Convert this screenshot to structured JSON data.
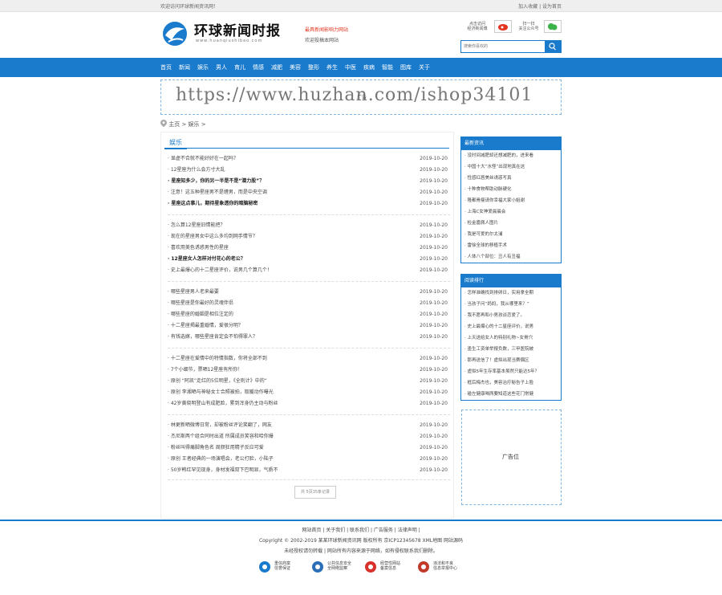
{
  "topbar": {
    "welcome": "欢迎访问环球新闻资讯网！",
    "links": "加入收藏 | 设为首页"
  },
  "header": {
    "site_name": "环球新闻时报",
    "site_url": "www.huanqiushibao.com",
    "slogan": "最具新闻影响力网站",
    "contribute": "欢迎投稿本网站",
    "weibo_text": [
      "点击访问",
      "经济新闻博"
    ],
    "wechat_text": [
      "扫一扫",
      "关注公众号"
    ],
    "search_placeholder": "搜索你喜欢的",
    "accent": "#1a7bcc"
  },
  "nav": [
    "首页",
    "新闻",
    "娱乐",
    "男人",
    "育儿",
    "情感",
    "减肥",
    "美容",
    "整形",
    "养生",
    "中医",
    "疾病",
    "智能",
    "图库",
    "关于"
  ],
  "banner": {
    "text": "https://www.huzhan.com/ishop34101",
    "overlay": "广告"
  },
  "breadcrumb": "主页 > 娱乐 >",
  "section_title": "娱乐",
  "groups": [
    [
      {
        "title": "显虚不合就不能好好在一起吗？",
        "date": "2019-10-20",
        "bold": false
      },
      {
        "title": "12星座为什么会方寸大乱",
        "date": "2019-10-20",
        "bold": false
      },
      {
        "title": "星座知多少，你的另一半是不是“潜力股”？",
        "date": "2019-10-20",
        "bold": true
      },
      {
        "title": "注意！这五种星座男不是缠男，而是中央空调",
        "date": "2019-10-20",
        "bold": false
      },
      {
        "title": "星座这点事儿，期待星象透你的暗脑秘密",
        "date": "2019-10-20",
        "bold": true
      }
    ],
    [
      {
        "title": "怎么算12星座旧情能把？",
        "date": "2019-10-20",
        "bold": false
      },
      {
        "title": "现在的星座男女中这么多均到网手情节？",
        "date": "2019-10-20",
        "bold": false
      },
      {
        "title": "喜欢用美色诱惑男性的星座",
        "date": "2019-10-20",
        "bold": false
      },
      {
        "title": "12星座女人怎样对付花心的老公？",
        "date": "2019-10-20",
        "bold": true
      },
      {
        "title": "史上最爆心的十二星座评价，说男几个算几个！",
        "date": "2019-10-20",
        "bold": false
      }
    ],
    [
      {
        "title": "哪些星座男人老来最要",
        "date": "2019-10-20",
        "bold": false
      },
      {
        "title": "哪些星座是你最好的灵魂伴侣",
        "date": "2019-10-20",
        "bold": false
      },
      {
        "title": "哪些星座的婚姻是相位注定的",
        "date": "2019-10-20",
        "bold": false
      },
      {
        "title": "十二星座揭最重婚情，爱很分明？",
        "date": "2019-10-20",
        "bold": false
      },
      {
        "title": "有钱选嫁，哪些星座肯定会不怕得罪人？",
        "date": "2019-10-20",
        "bold": false
      }
    ],
    [
      {
        "title": "十二星座在爱情中的特情指数，你将全部不到",
        "date": "2019-10-20",
        "bold": false
      },
      {
        "title": "7个小细节，票晒12星座有所你！",
        "date": "2019-10-20",
        "bold": false
      },
      {
        "title": "原创 “阿凯”走红的5位明星，《全则计》中的“",
        "date": "2019-10-20",
        "bold": false
      },
      {
        "title": "原创 李湘晒与神秘女士合照被拍，取暖动作曝光",
        "date": "2019-10-20",
        "bold": false
      },
      {
        "title": "42岁黄晓明登山有成肥脸，累到浑身仍主动与粉丝",
        "date": "2019-10-20",
        "bold": false
      }
    ],
    [
      {
        "title": "林更新晒微博日常，却被粉丝评论笑翻了，网友",
        "date": "2019-10-20",
        "bold": false
      },
      {
        "title": "杰尼斯两个组合同时出道 所属成员笑容和哈你爆",
        "date": "2019-10-20",
        "bold": false
      },
      {
        "title": "粉丝叫得痛脚角色名 周颜狂用精子反应可爱",
        "date": "2019-10-20",
        "bold": false
      },
      {
        "title": "原创 王者经典的一场演唱会，老公打脸，小陆子",
        "date": "2019-10-20",
        "bold": false
      },
      {
        "title": "50岁韩红罕见现身，身材发福双下巴明显，气质不",
        "date": "2019-10-20",
        "bold": false
      }
    ]
  ],
  "pager": "共 5页35条记录",
  "sidebar": {
    "latest_title": "最新资讯",
    "latest": [
      "没时间减肥却还想减肥的，进来看",
      "中国十大“水怪”出现地真在这",
      "性感红唇美丝诱惑写真",
      "十种食物帮助动脉硬化",
      "隆都骨瘦请你幸福大家小姐谢",
      "上海C女神爱晨晨会",
      "检金嘉佩人图片",
      "我是可爱的尔太浦",
      "雷徐全球的移植手术",
      "人体八个部位：丑人有丑福"
    ],
    "hot_title": "阅读排行",
    "hot": [
      "怎样准确找到排卵日，实用拿全期",
      "当孩子问“妈妈，我从哪里来？”",
      "我不愿再和小男孩谈恋爱了。",
      "史上最爆心的十二星座评价，说男",
      "上天送给女人的特别礼物~女骨穴",
      "墨生工资单举报负数，三甲医院被",
      "那再送信了！虚拟出现当赛偶区",
      "虚拟5年生存率基本虽然只能达5年？",
      "框后梅杰也，美容治疗秘告子上脸",
      "碰左健康喝两要知道这些花门常健"
    ],
    "ad_label": "广告位"
  },
  "footer": {
    "links": "网站首页 | 关于我们 | 联系我们 | 广告服务 | 法律声明 |",
    "copyright": "Copyright © 2002-2019 某某环球新闻资讯网 版权所有 京ICP12345678 XML地图 网站源码",
    "notice": "未经授权请勿转载 | 网站所有内容来源于网络，如有侵权联系我们删除。",
    "badges": [
      {
        "l1": "重信商富",
        "l2": "信誉保证"
      },
      {
        "l1": "公共信息安全",
        "l2": "全网络监察"
      },
      {
        "l1": "经营性网站",
        "l2": "备案信息"
      },
      {
        "l1": "违法和不良",
        "l2": "信息举报中心"
      }
    ]
  }
}
